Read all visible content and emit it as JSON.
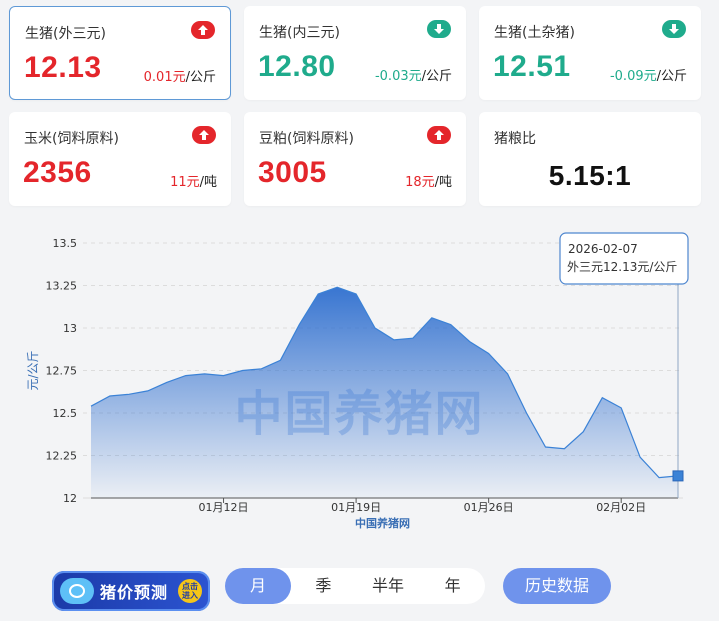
{
  "cards": [
    {
      "name": "生猪(外三元)",
      "price": "12.13",
      "change_val": "0.01元",
      "change_unit": "/公斤",
      "trend": "up"
    },
    {
      "name": "生猪(内三元)",
      "price": "12.80",
      "change_val": "-0.03元",
      "change_unit": "/公斤",
      "trend": "down"
    },
    {
      "name": "生猪(土杂猪)",
      "price": "12.51",
      "change_val": "-0.09元",
      "change_unit": "/公斤",
      "trend": "down"
    },
    {
      "name": "玉米(饲料原料)",
      "price": "2356",
      "change_val": "11元",
      "change_unit": "/吨",
      "trend": "up"
    },
    {
      "name": "豆粕(饲料原料)",
      "price": "3005",
      "change_val": "18元",
      "change_unit": "/吨",
      "trend": "up"
    },
    {
      "name": "猪粮比",
      "price": "5.15:1",
      "trend": "neutral"
    }
  ],
  "chart_data": {
    "type": "area",
    "ylabel": "元/公斤",
    "xlabel": "中国养猪网",
    "watermark": "中国养猪网",
    "ylim": [
      12,
      13.5
    ],
    "yticks": [
      12,
      12.25,
      12.5,
      12.75,
      13,
      13.25,
      13.5
    ],
    "ytick_labels": [
      "12",
      "12.25",
      "12.5",
      "12.75",
      "13",
      "13.25",
      "13.5"
    ],
    "x_start": "2026-01-05",
    "xtick_dates": [
      "2026-01-12",
      "2026-01-19",
      "2026-01-26",
      "2026-02-02"
    ],
    "xtick_labels": [
      "01月12日",
      "01月19日",
      "01月26日",
      "02月02日"
    ],
    "values": [
      12.54,
      12.6,
      12.61,
      12.63,
      12.68,
      12.72,
      12.73,
      12.72,
      12.75,
      12.76,
      12.81,
      13.02,
      13.2,
      13.24,
      13.2,
      13.0,
      12.93,
      12.94,
      13.06,
      13.02,
      12.92,
      12.85,
      12.73,
      12.5,
      12.3,
      12.29,
      12.39,
      12.59,
      12.53,
      12.24,
      12.12,
      12.13
    ],
    "color": "#3a7bd5",
    "tooltip": {
      "date": "2026-02-07",
      "text": "外三元12.13元/公斤"
    }
  },
  "controls": {
    "promo_label": "猪价预测",
    "promo_badge": "点击进入",
    "tabs": [
      "月",
      "季",
      "半年",
      "年"
    ],
    "active_tab": "月",
    "history_label": "历史数据"
  }
}
